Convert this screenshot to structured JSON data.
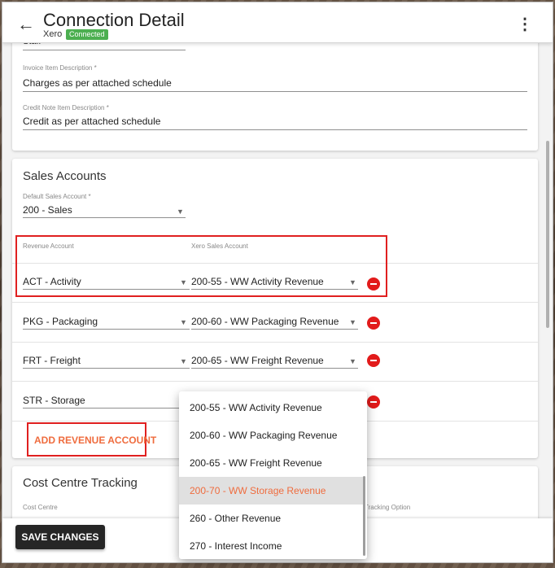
{
  "header": {
    "title": "Connection Detail",
    "subtitle": "Xero",
    "badge": "Connected",
    "back_icon": "←",
    "more_icon": "⋮"
  },
  "description_card": {
    "partial_value": "Staff",
    "invoice_label": "Invoice Item Description *",
    "invoice_value": "Charges as per attached schedule",
    "credit_label": "Credit Note Item Description *",
    "credit_value": "Credit as per attached schedule"
  },
  "sales_accounts": {
    "title": "Sales Accounts",
    "default_label": "Default Sales Account *",
    "default_value": "200 - Sales",
    "col_revenue": "Revenue Account",
    "col_xero": "Xero Sales Account",
    "rows": [
      {
        "revenue": "ACT - Activity",
        "xero": "200-55 - WW Activity Revenue"
      },
      {
        "revenue": "PKG - Packaging",
        "xero": "200-60 - WW Packaging Revenue"
      },
      {
        "revenue": "FRT - Freight",
        "xero": "200-65 - WW Freight Revenue"
      },
      {
        "revenue": "STR - Storage",
        "xero": ""
      }
    ],
    "add_button": "ADD REVENUE ACCOUNT"
  },
  "cost_centre": {
    "title": "Cost Centre Tracking",
    "cost_centre_label": "Cost Centre",
    "tracking_label": "Tracking Option"
  },
  "footer": {
    "save_label": "SAVE CHANGES"
  },
  "dropdown": {
    "options": [
      "200-55 - WW Activity Revenue",
      "200-60 - WW Packaging Revenue",
      "200-65 - WW Freight Revenue",
      "200-70 - WW Storage Revenue",
      "260 - Other Revenue",
      "270 - Interest Income"
    ],
    "selected": "200-70 - WW Storage Revenue"
  },
  "colors": {
    "accent": "#ef6c3e",
    "badge": "#4caf50",
    "remove": "#e21b1b",
    "highlight": "#e02020"
  }
}
